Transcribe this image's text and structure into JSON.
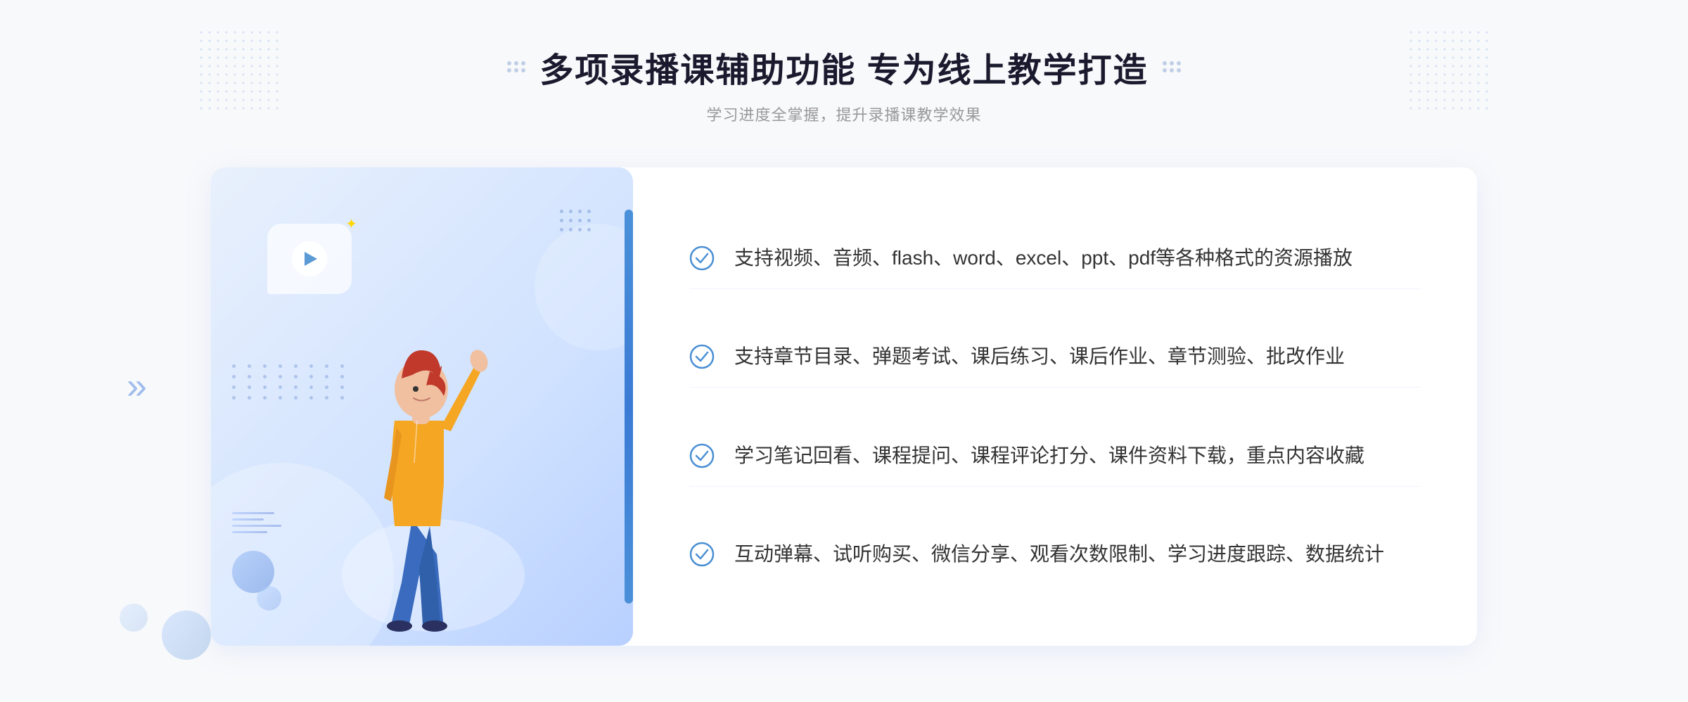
{
  "header": {
    "title": "多项录播课辅助功能 专为线上教学打造",
    "subtitle": "学习进度全掌握，提升录播课教学效果",
    "title_dots_label": "decorative dots"
  },
  "features": [
    {
      "id": 1,
      "text": "支持视频、音频、flash、word、excel、ppt、pdf等各种格式的资源播放"
    },
    {
      "id": 2,
      "text": "支持章节目录、弹题考试、课后练习、课后作业、章节测验、批改作业"
    },
    {
      "id": 3,
      "text": "学习笔记回看、课程提问、课程评论打分、课件资料下载，重点内容收藏"
    },
    {
      "id": 4,
      "text": "互动弹幕、试听购买、微信分享、观看次数限制、学习进度跟踪、数据统计"
    }
  ],
  "colors": {
    "accent_blue": "#4a8fd4",
    "light_blue_bg": "#e8f0fc",
    "check_circle": "#5b9bd5",
    "text_dark": "#333333",
    "text_gray": "#999999"
  },
  "icons": {
    "check": "check-circle",
    "play": "play-icon",
    "chevron_left": "«"
  }
}
